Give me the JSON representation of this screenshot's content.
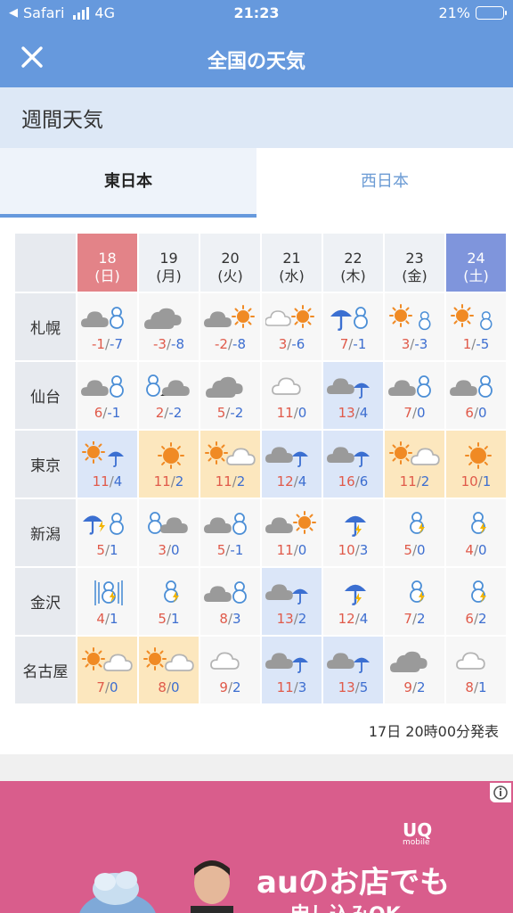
{
  "status": {
    "carrier": "Safari",
    "network": "4G",
    "time": "21:23",
    "battery": "21%",
    "battery_level": 0.21
  },
  "nav": {
    "title": "全国の天気",
    "close_icon": "close-icon"
  },
  "section": {
    "title": "週間天気"
  },
  "tabs": [
    {
      "label": "東日本",
      "active": true
    },
    {
      "label": "西日本",
      "active": false
    }
  ],
  "days": [
    {
      "date": "18",
      "dow": "(日)",
      "kind": "sun"
    },
    {
      "date": "19",
      "dow": "(月)",
      "kind": "normal"
    },
    {
      "date": "20",
      "dow": "(火)",
      "kind": "normal"
    },
    {
      "date": "21",
      "dow": "(水)",
      "kind": "normal"
    },
    {
      "date": "22",
      "dow": "(木)",
      "kind": "normal"
    },
    {
      "date": "23",
      "dow": "(金)",
      "kind": "normal"
    },
    {
      "date": "24",
      "dow": "(土)",
      "kind": "sat"
    }
  ],
  "cities": [
    {
      "name": "札幌",
      "forecast": [
        {
          "icon": "cloud-snow",
          "hi": "-1",
          "lo": "-7",
          "bg": "none"
        },
        {
          "icon": "cloud",
          "hi": "-3",
          "lo": "-8",
          "bg": "none"
        },
        {
          "icon": "cloud-sun",
          "hi": "-2",
          "lo": "-8",
          "bg": "none"
        },
        {
          "icon": "cloud-sun-light",
          "hi": "3",
          "lo": "-6",
          "bg": "none"
        },
        {
          "icon": "rain-snow",
          "hi": "7",
          "lo": "-1",
          "bg": "none"
        },
        {
          "icon": "sun-snow",
          "hi": "3",
          "lo": "-3",
          "bg": "none"
        },
        {
          "icon": "sun-snow",
          "hi": "1",
          "lo": "-5",
          "bg": "none"
        }
      ]
    },
    {
      "name": "仙台",
      "forecast": [
        {
          "icon": "cloud-snow",
          "hi": "6",
          "lo": "-1",
          "bg": "none"
        },
        {
          "icon": "snow-then-cloud",
          "hi": "2",
          "lo": "-2",
          "bg": "none"
        },
        {
          "icon": "cloud",
          "hi": "5",
          "lo": "-2",
          "bg": "none"
        },
        {
          "icon": "cloud-light",
          "hi": "11",
          "lo": "0",
          "bg": "none"
        },
        {
          "icon": "cloud-rain",
          "hi": "13",
          "lo": "4",
          "bg": "rain"
        },
        {
          "icon": "cloud-snow",
          "hi": "7",
          "lo": "0",
          "bg": "none"
        },
        {
          "icon": "cloud-snow",
          "hi": "6",
          "lo": "0",
          "bg": "none"
        }
      ]
    },
    {
      "name": "東京",
      "forecast": [
        {
          "icon": "sun-rain",
          "hi": "11",
          "lo": "4",
          "bg": "rain"
        },
        {
          "icon": "sun",
          "hi": "11",
          "lo": "2",
          "bg": "hot"
        },
        {
          "icon": "sun-cloud",
          "hi": "11",
          "lo": "2",
          "bg": "hot"
        },
        {
          "icon": "cloud-rain",
          "hi": "12",
          "lo": "4",
          "bg": "rain"
        },
        {
          "icon": "cloud-rain",
          "hi": "16",
          "lo": "6",
          "bg": "rain"
        },
        {
          "icon": "sun-cloud",
          "hi": "11",
          "lo": "2",
          "bg": "hot"
        },
        {
          "icon": "sun",
          "hi": "10",
          "lo": "1",
          "bg": "hot"
        }
      ]
    },
    {
      "name": "新潟",
      "forecast": [
        {
          "icon": "rain-thunder-snow",
          "hi": "5",
          "lo": "1",
          "bg": "none"
        },
        {
          "icon": "snow-cloud",
          "hi": "3",
          "lo": "0",
          "bg": "none"
        },
        {
          "icon": "cloud-snow",
          "hi": "5",
          "lo": "-1",
          "bg": "none"
        },
        {
          "icon": "cloud-sun",
          "hi": "11",
          "lo": "0",
          "bg": "none"
        },
        {
          "icon": "rain-thunder",
          "hi": "10",
          "lo": "3",
          "bg": "none"
        },
        {
          "icon": "snow-thunder",
          "hi": "5",
          "lo": "0",
          "bg": "none"
        },
        {
          "icon": "snow-thunder",
          "hi": "4",
          "lo": "0",
          "bg": "none"
        }
      ]
    },
    {
      "name": "金沢",
      "forecast": [
        {
          "icon": "heavy-snow-thunder",
          "hi": "4",
          "lo": "1",
          "bg": "none"
        },
        {
          "icon": "snow-thunder",
          "hi": "5",
          "lo": "1",
          "bg": "none"
        },
        {
          "icon": "cloud-snow",
          "hi": "8",
          "lo": "3",
          "bg": "none"
        },
        {
          "icon": "cloud-rain",
          "hi": "13",
          "lo": "2",
          "bg": "rain"
        },
        {
          "icon": "rain-thunder",
          "hi": "12",
          "lo": "4",
          "bg": "none"
        },
        {
          "icon": "snow-thunder",
          "hi": "7",
          "lo": "2",
          "bg": "none"
        },
        {
          "icon": "snow-thunder",
          "hi": "6",
          "lo": "2",
          "bg": "none"
        }
      ]
    },
    {
      "name": "名古屋",
      "forecast": [
        {
          "icon": "sun-cloud",
          "hi": "7",
          "lo": "0",
          "bg": "hot"
        },
        {
          "icon": "sun-cloud",
          "hi": "8",
          "lo": "0",
          "bg": "hot"
        },
        {
          "icon": "cloud-light",
          "hi": "9",
          "lo": "2",
          "bg": "none"
        },
        {
          "icon": "cloud-rain",
          "hi": "11",
          "lo": "3",
          "bg": "rain"
        },
        {
          "icon": "cloud-rain",
          "hi": "13",
          "lo": "5",
          "bg": "rain"
        },
        {
          "icon": "cloud",
          "hi": "9",
          "lo": "2",
          "bg": "none"
        },
        {
          "icon": "cloud-light",
          "hi": "8",
          "lo": "1",
          "bg": "none"
        }
      ]
    }
  ],
  "issued": "17日 20時00分発表",
  "ad": {
    "brand": "UQ",
    "brand_sub": "mobile",
    "headline": "auのお店でも",
    "sub": "申し込みOK"
  }
}
